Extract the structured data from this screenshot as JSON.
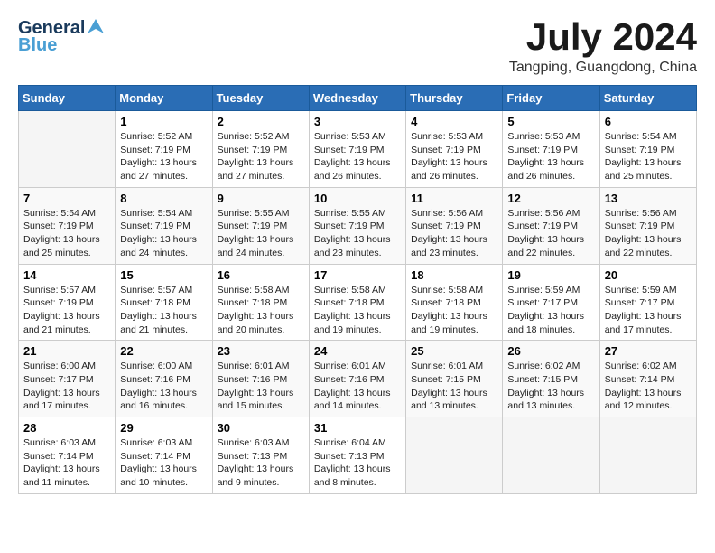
{
  "header": {
    "logo_general": "General",
    "logo_blue": "Blue",
    "month": "July 2024",
    "location": "Tangping, Guangdong, China"
  },
  "weekdays": [
    "Sunday",
    "Monday",
    "Tuesday",
    "Wednesday",
    "Thursday",
    "Friday",
    "Saturday"
  ],
  "weeks": [
    [
      {
        "day": "",
        "info": ""
      },
      {
        "day": "1",
        "info": "Sunrise: 5:52 AM\nSunset: 7:19 PM\nDaylight: 13 hours\nand 27 minutes."
      },
      {
        "day": "2",
        "info": "Sunrise: 5:52 AM\nSunset: 7:19 PM\nDaylight: 13 hours\nand 27 minutes."
      },
      {
        "day": "3",
        "info": "Sunrise: 5:53 AM\nSunset: 7:19 PM\nDaylight: 13 hours\nand 26 minutes."
      },
      {
        "day": "4",
        "info": "Sunrise: 5:53 AM\nSunset: 7:19 PM\nDaylight: 13 hours\nand 26 minutes."
      },
      {
        "day": "5",
        "info": "Sunrise: 5:53 AM\nSunset: 7:19 PM\nDaylight: 13 hours\nand 26 minutes."
      },
      {
        "day": "6",
        "info": "Sunrise: 5:54 AM\nSunset: 7:19 PM\nDaylight: 13 hours\nand 25 minutes."
      }
    ],
    [
      {
        "day": "7",
        "info": "Sunrise: 5:54 AM\nSunset: 7:19 PM\nDaylight: 13 hours\nand 25 minutes."
      },
      {
        "day": "8",
        "info": "Sunrise: 5:54 AM\nSunset: 7:19 PM\nDaylight: 13 hours\nand 24 minutes."
      },
      {
        "day": "9",
        "info": "Sunrise: 5:55 AM\nSunset: 7:19 PM\nDaylight: 13 hours\nand 24 minutes."
      },
      {
        "day": "10",
        "info": "Sunrise: 5:55 AM\nSunset: 7:19 PM\nDaylight: 13 hours\nand 23 minutes."
      },
      {
        "day": "11",
        "info": "Sunrise: 5:56 AM\nSunset: 7:19 PM\nDaylight: 13 hours\nand 23 minutes."
      },
      {
        "day": "12",
        "info": "Sunrise: 5:56 AM\nSunset: 7:19 PM\nDaylight: 13 hours\nand 22 minutes."
      },
      {
        "day": "13",
        "info": "Sunrise: 5:56 AM\nSunset: 7:19 PM\nDaylight: 13 hours\nand 22 minutes."
      }
    ],
    [
      {
        "day": "14",
        "info": "Sunrise: 5:57 AM\nSunset: 7:19 PM\nDaylight: 13 hours\nand 21 minutes."
      },
      {
        "day": "15",
        "info": "Sunrise: 5:57 AM\nSunset: 7:18 PM\nDaylight: 13 hours\nand 21 minutes."
      },
      {
        "day": "16",
        "info": "Sunrise: 5:58 AM\nSunset: 7:18 PM\nDaylight: 13 hours\nand 20 minutes."
      },
      {
        "day": "17",
        "info": "Sunrise: 5:58 AM\nSunset: 7:18 PM\nDaylight: 13 hours\nand 19 minutes."
      },
      {
        "day": "18",
        "info": "Sunrise: 5:58 AM\nSunset: 7:18 PM\nDaylight: 13 hours\nand 19 minutes."
      },
      {
        "day": "19",
        "info": "Sunrise: 5:59 AM\nSunset: 7:17 PM\nDaylight: 13 hours\nand 18 minutes."
      },
      {
        "day": "20",
        "info": "Sunrise: 5:59 AM\nSunset: 7:17 PM\nDaylight: 13 hours\nand 17 minutes."
      }
    ],
    [
      {
        "day": "21",
        "info": "Sunrise: 6:00 AM\nSunset: 7:17 PM\nDaylight: 13 hours\nand 17 minutes."
      },
      {
        "day": "22",
        "info": "Sunrise: 6:00 AM\nSunset: 7:16 PM\nDaylight: 13 hours\nand 16 minutes."
      },
      {
        "day": "23",
        "info": "Sunrise: 6:01 AM\nSunset: 7:16 PM\nDaylight: 13 hours\nand 15 minutes."
      },
      {
        "day": "24",
        "info": "Sunrise: 6:01 AM\nSunset: 7:16 PM\nDaylight: 13 hours\nand 14 minutes."
      },
      {
        "day": "25",
        "info": "Sunrise: 6:01 AM\nSunset: 7:15 PM\nDaylight: 13 hours\nand 13 minutes."
      },
      {
        "day": "26",
        "info": "Sunrise: 6:02 AM\nSunset: 7:15 PM\nDaylight: 13 hours\nand 13 minutes."
      },
      {
        "day": "27",
        "info": "Sunrise: 6:02 AM\nSunset: 7:14 PM\nDaylight: 13 hours\nand 12 minutes."
      }
    ],
    [
      {
        "day": "28",
        "info": "Sunrise: 6:03 AM\nSunset: 7:14 PM\nDaylight: 13 hours\nand 11 minutes."
      },
      {
        "day": "29",
        "info": "Sunrise: 6:03 AM\nSunset: 7:14 PM\nDaylight: 13 hours\nand 10 minutes."
      },
      {
        "day": "30",
        "info": "Sunrise: 6:03 AM\nSunset: 7:13 PM\nDaylight: 13 hours\nand 9 minutes."
      },
      {
        "day": "31",
        "info": "Sunrise: 6:04 AM\nSunset: 7:13 PM\nDaylight: 13 hours\nand 8 minutes."
      },
      {
        "day": "",
        "info": ""
      },
      {
        "day": "",
        "info": ""
      },
      {
        "day": "",
        "info": ""
      }
    ]
  ]
}
